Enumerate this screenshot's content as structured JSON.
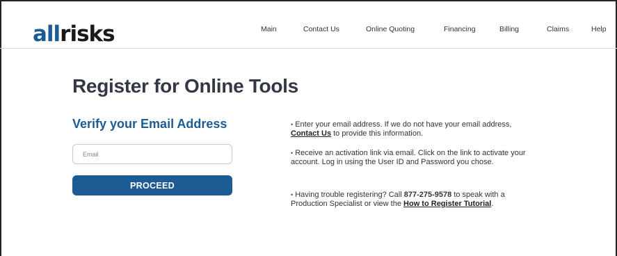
{
  "logo": {
    "part1": "all",
    "part2": "risks"
  },
  "nav": {
    "items": [
      {
        "label": "Main"
      },
      {
        "label": "Contact Us"
      },
      {
        "label": "Online Quoting"
      },
      {
        "label": "Financing"
      },
      {
        "label": "Billing"
      },
      {
        "label": "Claims"
      },
      {
        "label": "Help"
      }
    ]
  },
  "page": {
    "title": "Register for Online Tools",
    "subtitle": "Verify your Email Address"
  },
  "form": {
    "email_placeholder": "Email",
    "email_value": "",
    "proceed_label": "PROCEED"
  },
  "info": {
    "bullet": "•",
    "p1_before": "Enter your email address. If we do not have your email address, ",
    "p1_link": "Contact Us",
    "p1_after": " to provide this information.",
    "p2": "Receive an activation link via email. Click on the link to activate your account. Log in using the User ID and Password you chose.",
    "p3_before": "Having trouble registering? Call ",
    "p3_phone": "877-275-9578",
    "p3_middle": " to speak with a Production Specialist or view the ",
    "p3_link": "How to Register Tutorial",
    "p3_after": "."
  }
}
